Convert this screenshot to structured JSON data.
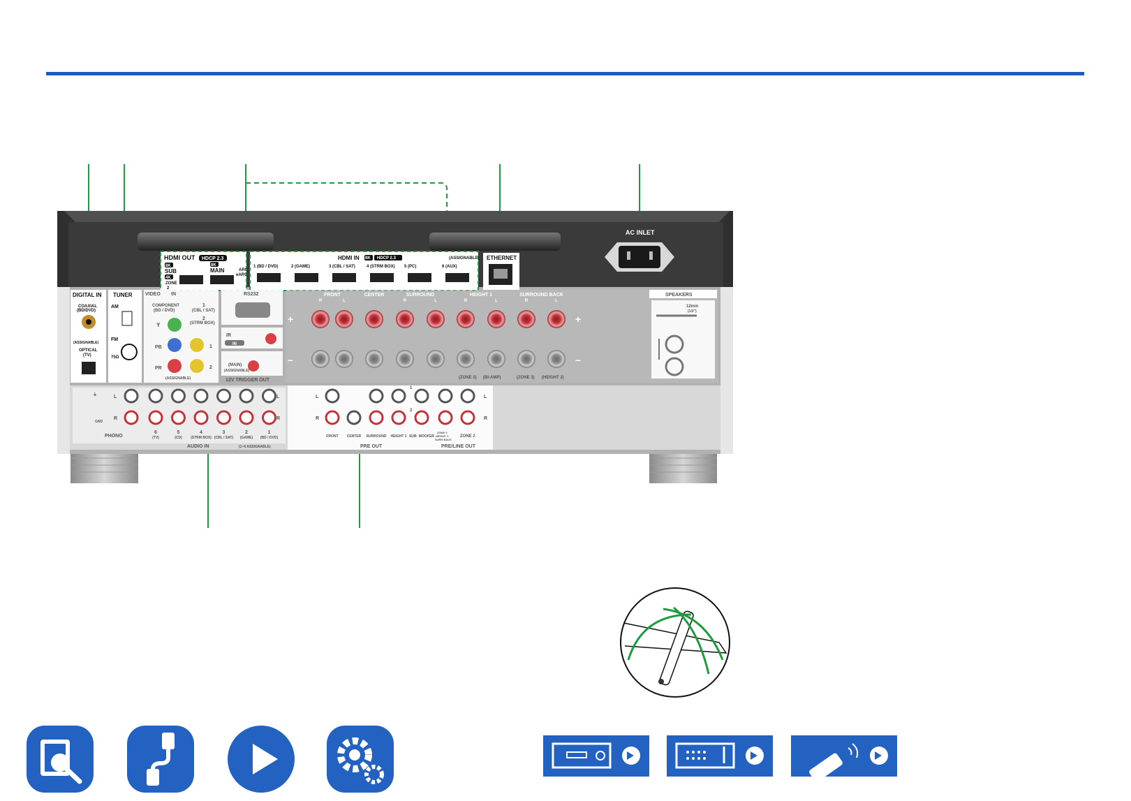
{
  "panel": {
    "digital_in": {
      "title": "DIGITAL IN",
      "coaxial": "COAXIAL",
      "coaxial_sub": "(BD/DVD)",
      "assignable": "(ASSIGNABLE)",
      "optical": "OPTICAL",
      "optical_sub": "(TV)"
    },
    "tuner": {
      "title": "TUNER",
      "am": "AM",
      "fm": "FM",
      "ohm": "75Ω"
    },
    "hdmi_out": {
      "title": "HDMI OUT",
      "hdcp": "HDCP 2.3",
      "sub_badge": "8K",
      "sub": "SUB",
      "zone_badge": "4K",
      "zone": "ZONE",
      "zone_num": "2",
      "main_badge": "8K",
      "main": "MAIN",
      "arc": "ARC",
      "earc": "eARC"
    },
    "hdmi_in": {
      "title": "HDMI IN",
      "badge": "8K",
      "hdcp": "HDCP 2.3",
      "assignable": "(ASSIGNABLE)",
      "ports": [
        "1 (BD / DVD)",
        "2 (GAME)",
        "3 (CBL / SAT)",
        "4 (STRM BOX)",
        "5 (PC)",
        "6 (AUX)"
      ]
    },
    "ethernet": "ETHERNET",
    "ac_inlet": "AC INLET",
    "video_in": {
      "title": "VIDEO",
      "in": "IN",
      "component": "COMPONENT",
      "component_sub": "(BD / DVD)",
      "y": "Y",
      "pb": "PB",
      "pr": "PR",
      "assignable": "(ASSIGNABLE)",
      "in1": "1",
      "in1_sub": "(CBL / SAT)",
      "in2": "2",
      "in2_sub": "(STRM BOX)",
      "num1": "1",
      "num2": "2"
    },
    "rs232": "RS232",
    "ir": "IR",
    "ir_in": "IN",
    "trigger": {
      "main": "(MAIN)",
      "assignable": "(ASSIGNABLE)",
      "title": "12V TRIGGER OUT"
    },
    "speakers": {
      "title": "SPEAKERS",
      "groups": [
        {
          "name": "FRONT",
          "r": "R",
          "l": "L"
        },
        {
          "name": "CENTER"
        },
        {
          "name": "SURROUND",
          "r": "R",
          "l": "L"
        },
        {
          "name": "HEIGHT 1",
          "r": "R",
          "l": "L"
        },
        {
          "name": "SURROUND BACK",
          "r": "R",
          "l": "L"
        }
      ],
      "plus": "+",
      "minus": "–",
      "zone2": "(ZONE 2)",
      "biamp": "(BI-AMP)",
      "zone3": "(ZONE 3)",
      "height2": "(HEIGHT 2)",
      "strip": "12mm",
      "strip_in": "(1/2\")"
    },
    "audio_in": {
      "phono": "PHONO",
      "gnd": "GND",
      "l": "L",
      "r": "R",
      "inputs": [
        {
          "num": "6",
          "name": "(TV)"
        },
        {
          "num": "5",
          "name": "(CD)"
        },
        {
          "num": "4",
          "name": "(STRM BOX)"
        },
        {
          "num": "3",
          "name": "(CBL / SAT)"
        },
        {
          "num": "2",
          "name": "(GAME)"
        },
        {
          "num": "1",
          "name": "(BD / DVD)"
        }
      ],
      "title": "AUDIO IN",
      "assignable": "(1~6 ASSIGNABLE)"
    },
    "pre_out": {
      "l": "L",
      "r": "R",
      "labels": [
        "FRONT",
        "CENTER",
        "SURROUND",
        "HEIGHT 1",
        "SUB- WOOFER"
      ],
      "sw1": "1",
      "sw2": "2",
      "zone3": "ZONE 3",
      "zone3_sub": "HEIGHT 2",
      "zone3_sub2": "SURR BACK",
      "zone2": "ZONE 2",
      "title": "PRE OUT",
      "title2": "PRE/LINE OUT"
    }
  },
  "bottom_nav": {
    "icons": [
      "book-search-icon",
      "cable-icon",
      "play-icon",
      "gear-icon"
    ],
    "buttons": [
      "front-panel-button",
      "rear-panel-button",
      "remote-control-button"
    ]
  },
  "colors": {
    "accent": "#1e5bbf",
    "callout": "#1e9b3c",
    "panel": "#3a3a3a",
    "terminal_red": "#c2333a"
  }
}
